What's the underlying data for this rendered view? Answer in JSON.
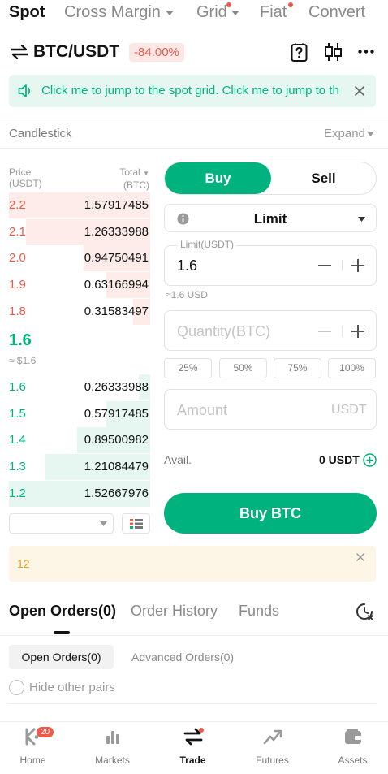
{
  "top_tabs": [
    {
      "label": "Spot"
    },
    {
      "label": "Cross Margin"
    },
    {
      "label": "Grid"
    },
    {
      "label": "Fiat"
    },
    {
      "label": "Convert"
    }
  ],
  "pair": {
    "name": "BTC/USDT",
    "change": "-84.00%"
  },
  "banner": {
    "text": "Click me to jump to the spot grid. Click me to jump to th"
  },
  "chart_toggle": {
    "label": "Candlestick",
    "expand": "Expand"
  },
  "order_book": {
    "price_header": "Price",
    "price_unit": "(USDT)",
    "total_header": "Total",
    "total_unit": "(BTC)",
    "asks": [
      {
        "price": "2.2",
        "total": "1.57917485",
        "depth": 1.0
      },
      {
        "price": "2.1",
        "total": "1.26333988",
        "depth": 0.88
      },
      {
        "price": "2.0",
        "total": "0.94750491",
        "depth": 0.47
      },
      {
        "price": "1.9",
        "total": "0.63166994",
        "depth": 0.31
      },
      {
        "price": "1.8",
        "total": "0.31583497",
        "depth": 0.12
      }
    ],
    "last_price": "1.6",
    "last_price_usd": "≈ $1.6",
    "bids": [
      {
        "price": "1.6",
        "total": "0.26333988",
        "depth": 0.08
      },
      {
        "price": "1.5",
        "total": "0.57917485",
        "depth": 0.31
      },
      {
        "price": "1.4",
        "total": "0.89500982",
        "depth": 0.52
      },
      {
        "price": "1.3",
        "total": "1.21084479",
        "depth": 0.74
      },
      {
        "price": "1.2",
        "total": "1.52667976",
        "depth": 1.0
      }
    ]
  },
  "form": {
    "buy_label": "Buy",
    "sell_label": "Sell",
    "order_type": "Limit",
    "limit_label": "Limit(USDT)",
    "limit_value": "1.6",
    "limit_usd": "≈1.6 USD",
    "quantity_placeholder": "Quantity(BTC)",
    "percents": [
      "25%",
      "50%",
      "75%",
      "100%"
    ],
    "amount_placeholder": "Amount",
    "amount_unit": "USDT",
    "avail_label": "Avail.",
    "avail_value": "0 USDT",
    "submit_label": "Buy BTC"
  },
  "notice": {
    "text": "12"
  },
  "orders_tabs": [
    {
      "label": "Open Orders(0)"
    },
    {
      "label": "Order History"
    },
    {
      "label": "Funds"
    }
  ],
  "orders_subtabs": [
    {
      "label": "Open Orders(0)"
    },
    {
      "label": "Advanced Orders(0)"
    }
  ],
  "hide_pairs": {
    "label": "Hide other pairs"
  },
  "bottom_nav": [
    {
      "label": "Home",
      "icon": "home-icon",
      "badge": "20"
    },
    {
      "label": "Markets",
      "icon": "markets-icon"
    },
    {
      "label": "Trade",
      "icon": "trade-icon"
    },
    {
      "label": "Futures",
      "icon": "futures-icon"
    },
    {
      "label": "Assets",
      "icon": "assets-icon"
    }
  ],
  "colors": {
    "accent": "#00b37e",
    "down": "#f0584a",
    "notice_bg": "#fdf6e6"
  }
}
